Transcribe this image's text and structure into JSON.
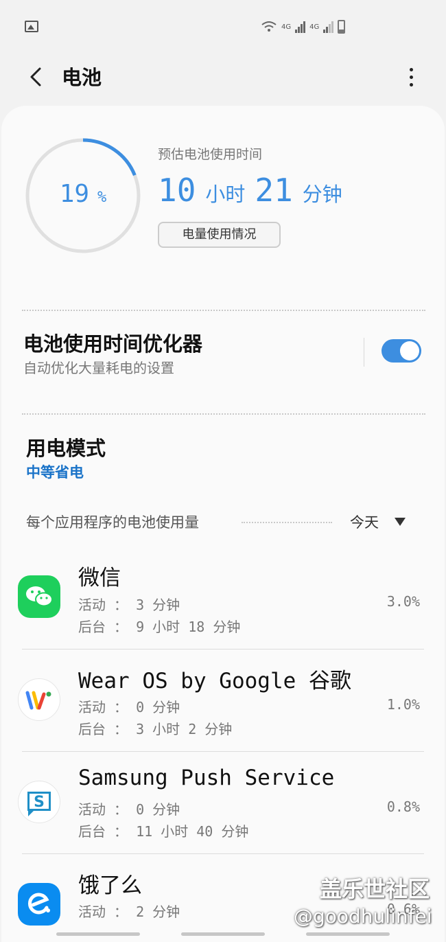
{
  "status_bar": {
    "left_icon": "image-icon",
    "icons": [
      "wifi-icon",
      "signal-4g-icon",
      "signal-4g-icon",
      "battery-icon"
    ],
    "net1": "4G",
    "net2": "4G"
  },
  "header": {
    "title": "电池",
    "back_icon": "chevron-left-icon",
    "more_icon": "more-vertical-icon"
  },
  "battery": {
    "level_fraction": 0.19,
    "percent_value": "19",
    "percent_unit": "%",
    "estimate_label": "预估电池使用时间",
    "hours": "10",
    "hours_unit": "小时",
    "minutes": "21",
    "minutes_unit": "分钟",
    "usage_button": "电量使用情况"
  },
  "optimizer": {
    "title": "电池使用时间优化器",
    "subtitle": "自动优化大量耗电的设置",
    "enabled": true
  },
  "power_mode": {
    "title": "用电模式",
    "value": "中等省电"
  },
  "per_app": {
    "label": "每个应用程序的电池使用量",
    "period": "今天"
  },
  "apps": [
    {
      "name": "微信",
      "active": "活动 ： 3 分钟",
      "background": "后台 ： 9 小时 18 分钟",
      "percent": "3.0%",
      "icon": "wechat-icon"
    },
    {
      "name": "Wear OS by Google 谷歌",
      "active": "活动 ： 0 分钟",
      "background": "后台 ： 3 小时 2 分钟",
      "percent": "1.0%",
      "icon": "wear-os-icon"
    },
    {
      "name": "Samsung Push Service",
      "active": "活动 ： 0 分钟",
      "background": "后台 ： 11 小时 40 分钟",
      "percent": "0.8%",
      "icon": "samsung-push-icon"
    },
    {
      "name": "饿了么",
      "active": "活动 ： 2 分钟",
      "background": "",
      "percent": "0.6%",
      "icon": "eleme-icon"
    }
  ],
  "watermark": {
    "line1": "盖乐世社区",
    "line2": "@goodhulinfei"
  },
  "colors": {
    "accent": "#3d8ee0",
    "mode_blue": "#1a73c8",
    "wechat_green": "#1ecf5c",
    "eleme_blue": "#0a8cf0"
  }
}
